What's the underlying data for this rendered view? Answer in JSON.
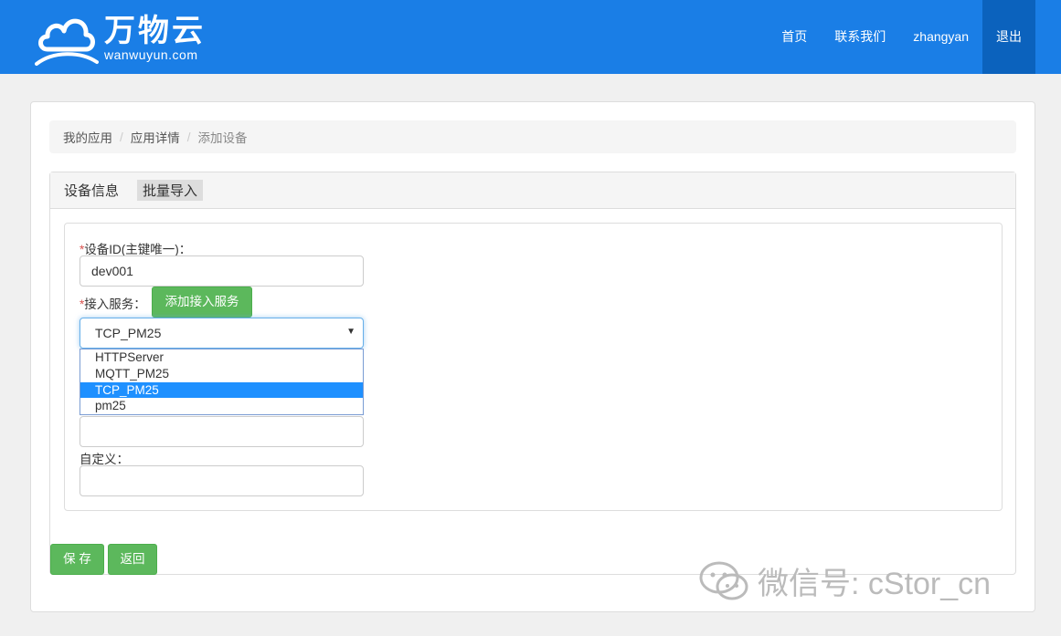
{
  "logo": {
    "cn": "万物云",
    "en": "wanwuyun.com"
  },
  "nav": {
    "home": "首页",
    "contact": "联系我们",
    "user": "zhangyan",
    "logout": "退出"
  },
  "breadcrumb": {
    "apps": "我的应用",
    "detail": "应用详情",
    "add": "添加设备",
    "sep": "/"
  },
  "tabs": {
    "device_info": "设备信息",
    "batch_import": "批量导入"
  },
  "form": {
    "required_mark": "*",
    "device_id_label": "设备ID(主键唯一)：",
    "device_id_value": "dev001",
    "service_label": "接入服务：",
    "add_service_button": "添加接入服务",
    "service_selected": "TCP_PM25",
    "service_options": [
      "HTTPServer",
      "MQTT_PM25",
      "TCP_PM25",
      "pm25"
    ],
    "custom_label": "自定义："
  },
  "actions": {
    "save": "保 存",
    "back": "返回"
  },
  "watermark": "微信号: cStor_cn",
  "colors": {
    "navbar": "#1a7ee6",
    "nav_active": "#0b62bd",
    "green": "#5cb85c",
    "option_selected": "#1e90ff"
  }
}
